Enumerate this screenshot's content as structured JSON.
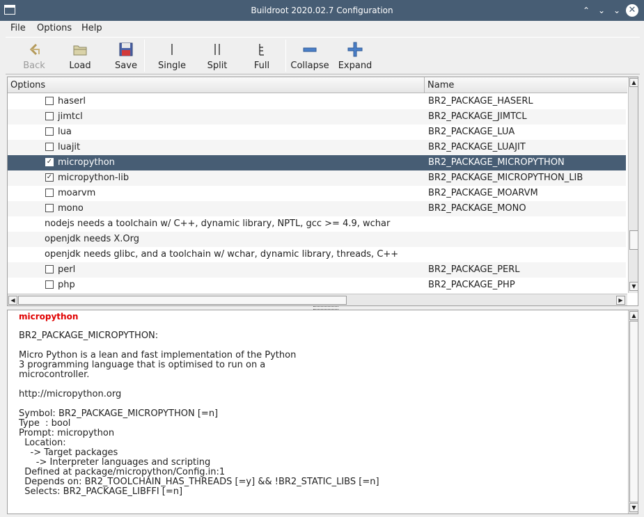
{
  "window": {
    "title": "Buildroot 2020.02.7 Configuration",
    "buttons": {
      "shade": "⌃",
      "minimize": "⌄",
      "maximize": "⌄",
      "close": "✕"
    }
  },
  "menu": {
    "file": "File",
    "options": "Options",
    "help": "Help"
  },
  "toolbar": {
    "back": "Back",
    "load": "Load",
    "save": "Save",
    "single": "Single",
    "split": "Split",
    "full": "Full",
    "collapse": "Collapse",
    "expand": "Expand",
    "colors": {
      "collapse_accent": "#4a7fc8",
      "expand_accent": "#4a7fc8"
    }
  },
  "tree": {
    "headers": {
      "options": "Options",
      "name": "Name"
    },
    "rows": [
      {
        "checkbox": true,
        "checked": false,
        "option": "haserl",
        "name": "BR2_PACKAGE_HASERL"
      },
      {
        "checkbox": true,
        "checked": false,
        "option": "jimtcl",
        "name": "BR2_PACKAGE_JIMTCL"
      },
      {
        "checkbox": true,
        "checked": false,
        "option": "lua",
        "name": "BR2_PACKAGE_LUA"
      },
      {
        "checkbox": true,
        "checked": false,
        "option": "luajit",
        "name": "BR2_PACKAGE_LUAJIT"
      },
      {
        "checkbox": true,
        "checked": true,
        "option": "micropython",
        "name": "BR2_PACKAGE_MICROPYTHON",
        "selected": true
      },
      {
        "checkbox": true,
        "checked": true,
        "option": "micropython-lib",
        "name": "BR2_PACKAGE_MICROPYTHON_LIB"
      },
      {
        "checkbox": true,
        "checked": false,
        "option": "moarvm",
        "name": "BR2_PACKAGE_MOARVM"
      },
      {
        "checkbox": true,
        "checked": false,
        "option": "mono",
        "name": "BR2_PACKAGE_MONO"
      },
      {
        "checkbox": false,
        "option": "nodejs needs a toolchain w/ C++, dynamic library, NPTL, gcc >= 4.9, wchar",
        "name": ""
      },
      {
        "checkbox": false,
        "option": "openjdk needs X.Org",
        "name": ""
      },
      {
        "checkbox": false,
        "option": "openjdk needs glibc, and a toolchain w/ wchar, dynamic library, threads, C++",
        "name": ""
      },
      {
        "checkbox": true,
        "checked": false,
        "option": "perl",
        "name": "BR2_PACKAGE_PERL"
      },
      {
        "checkbox": true,
        "checked": false,
        "option": "php",
        "name": "BR2_PACKAGE_PHP"
      }
    ],
    "colors": {
      "selected_row": "#475d74"
    }
  },
  "help": {
    "title": "micropython",
    "lines": [
      "",
      "BR2_PACKAGE_MICROPYTHON:",
      "",
      "Micro Python is a lean and fast implementation of the Python",
      "3 programming language that is optimised to run on a",
      "microcontroller.",
      "",
      "http://micropython.org",
      "",
      "Symbol: BR2_PACKAGE_MICROPYTHON [=n]",
      "Type  : bool",
      "Prompt: micropython",
      "  Location:",
      "    -> Target packages",
      "      -> Interpreter languages and scripting",
      "  Defined at package/micropython/Config.in:1",
      "  Depends on: BR2_TOOLCHAIN_HAS_THREADS [=y] && !BR2_STATIC_LIBS [=n]",
      "  Selects: BR2_PACKAGE_LIBFFI [=n]"
    ],
    "colors": {
      "title": "#e00000"
    }
  }
}
